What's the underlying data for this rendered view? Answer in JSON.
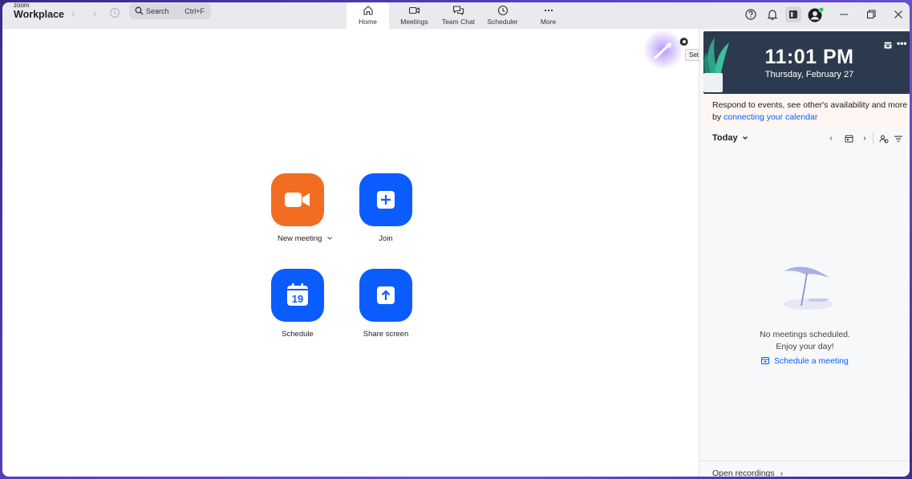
{
  "app": {
    "brand_small": "zoom",
    "brand_name": "Workplace"
  },
  "search": {
    "label": "Search",
    "shortcut": "Ctrl+F"
  },
  "tabs": [
    {
      "label": "Home",
      "icon": "home-icon",
      "active": true
    },
    {
      "label": "Meetings",
      "icon": "video-icon"
    },
    {
      "label": "Team Chat",
      "icon": "chat-icon"
    },
    {
      "label": "Scheduler",
      "icon": "clock-icon"
    },
    {
      "label": "More",
      "icon": "more-icon"
    }
  ],
  "main": {
    "settings_tooltip": "Settings",
    "actions": [
      {
        "label": "New meeting",
        "icon": "video-camera-icon",
        "color": "#f26d21",
        "has_dropdown": true
      },
      {
        "label": "Join",
        "icon": "plus-icon",
        "color": "#0b5cff"
      },
      {
        "label": "Schedule",
        "icon": "calendar-icon",
        "color": "#0b5cff",
        "calendar_day": "19"
      },
      {
        "label": "Share screen",
        "icon": "share-up-arrow-icon",
        "color": "#0b5cff"
      }
    ]
  },
  "side": {
    "time": "11:01 PM",
    "date": "Thursday, February 27",
    "promo_text": "Respond to events, see other's availability and more by",
    "promo_link": "connecting your calendar",
    "today_label": "Today",
    "empty_line1": "No meetings scheduled.",
    "empty_line2": "Enjoy your day!",
    "schedule_link": "Schedule a meeting",
    "recordings": "Open recordings"
  },
  "colors": {
    "accent": "#0b5cff",
    "orange": "#f26d21",
    "banner": "#2c3a4f",
    "presence": "#22c55e"
  }
}
